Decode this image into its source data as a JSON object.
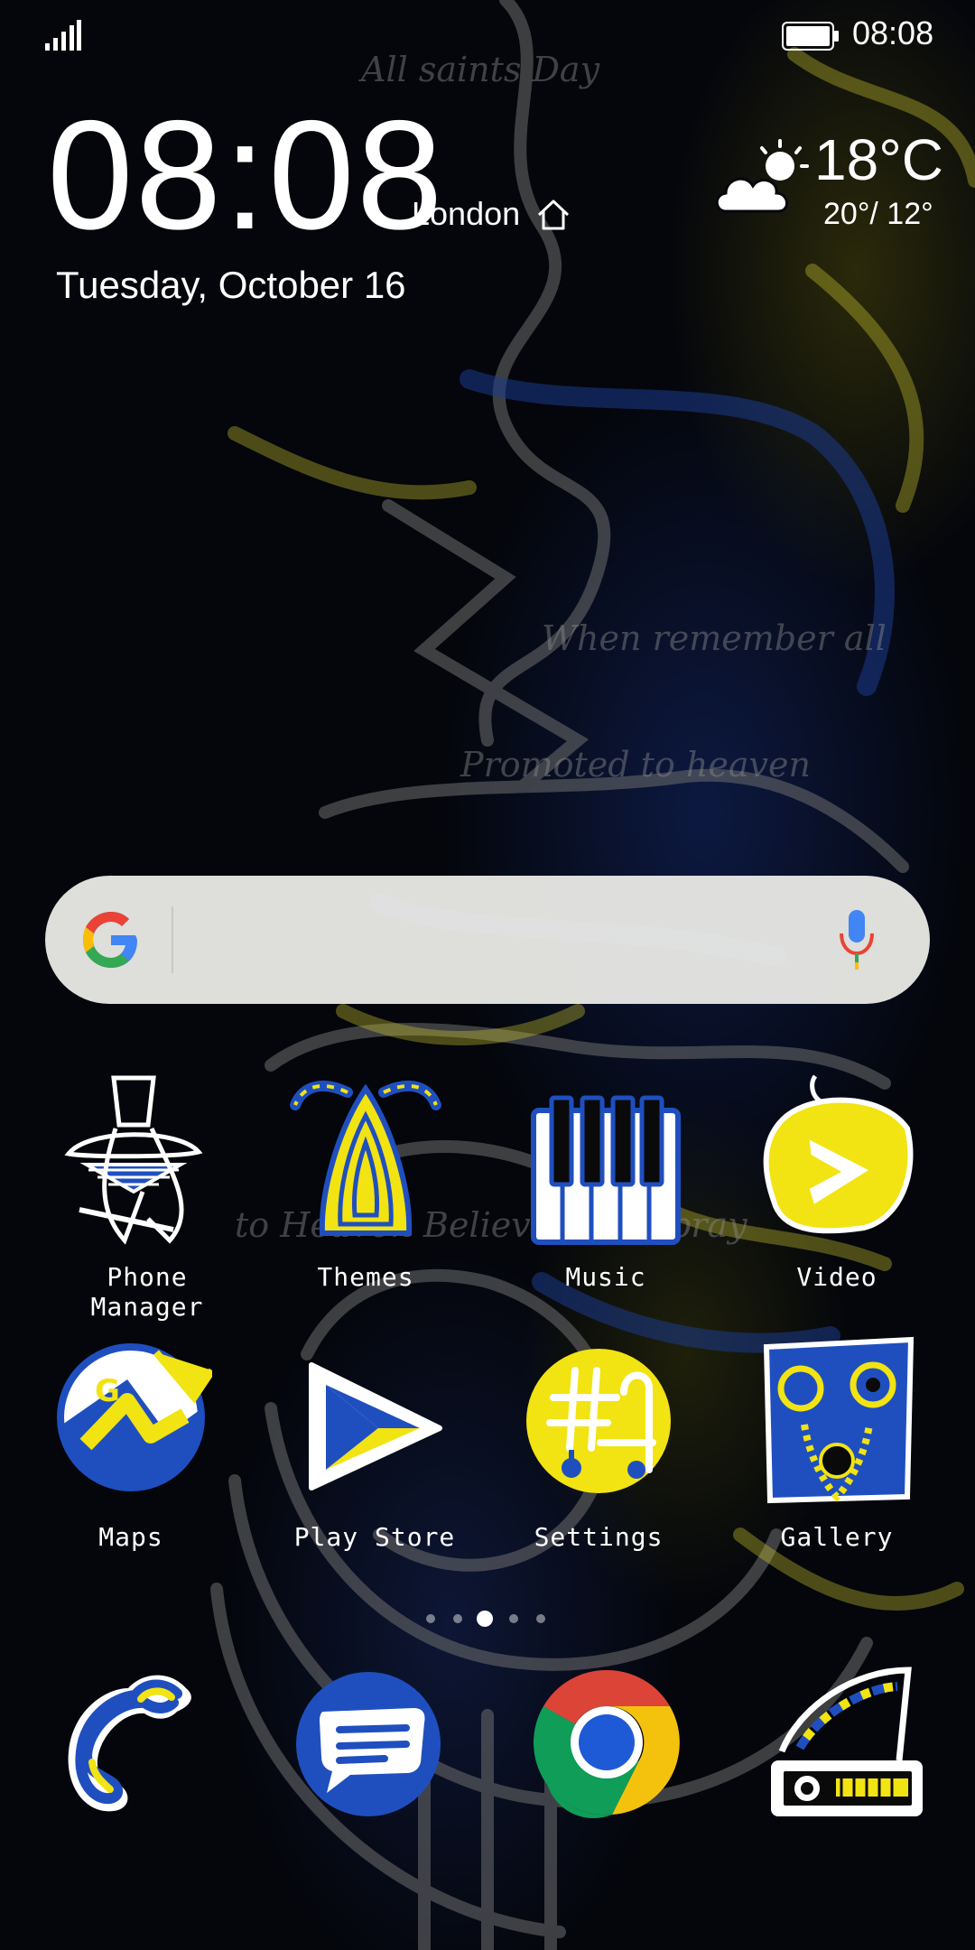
{
  "status_bar": {
    "time": "08:08"
  },
  "clock_widget": {
    "time": "08:08",
    "city": "London",
    "date": "Tuesday, October 16"
  },
  "weather_widget": {
    "temperature": "18°C",
    "range": "20°/ 12°",
    "condition_icon": "partly-cloudy-icon"
  },
  "search": {
    "provider_icon": "google-logo",
    "voice_icon": "mic-icon"
  },
  "apps": [
    {
      "label": "Phone Manager",
      "icon": "phone-manager-icon"
    },
    {
      "label": "Themes",
      "icon": "themes-icon"
    },
    {
      "label": "Music",
      "icon": "music-icon"
    },
    {
      "label": "Video",
      "icon": "video-icon"
    },
    {
      "label": "Maps",
      "icon": "maps-icon"
    },
    {
      "label": "Play Store",
      "icon": "play-store-icon"
    },
    {
      "label": "Settings",
      "icon": "settings-icon"
    },
    {
      "label": "Gallery",
      "icon": "gallery-icon"
    }
  ],
  "page_indicator": {
    "total_pages": 5,
    "current_page": 3
  },
  "dock": [
    {
      "icon": "phone-icon"
    },
    {
      "icon": "messages-icon"
    },
    {
      "icon": "chrome-icon"
    },
    {
      "icon": "camera-icon"
    }
  ],
  "colors": {
    "icon_blue": "#1f4fbf",
    "icon_yellow": "#f2e313",
    "search_bar": "#ececE8"
  }
}
